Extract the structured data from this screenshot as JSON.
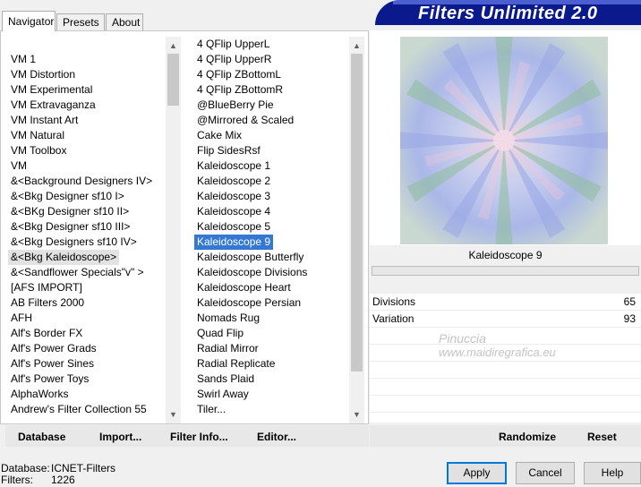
{
  "tabs": [
    "Navigator",
    "Presets",
    "About"
  ],
  "banner_title": "Filters Unlimited 2.0",
  "categories": [
    "VM 1",
    "VM Distortion",
    "VM Experimental",
    "VM Extravaganza",
    "VM Instant Art",
    "VM Natural",
    "VM Toolbox",
    "VM",
    "&<Background Designers IV>",
    "&<Bkg Designer sf10 I>",
    "&<BKg Designer sf10 II>",
    "&<Bkg Designer sf10 III>",
    "&<Bkg Designers sf10 IV>",
    "&<Bkg Kaleidoscope>",
    "&<Sandflower Specials\"v\" >",
    "[AFS IMPORT]",
    "AB Filters 2000",
    "AFH",
    "Alf's Border FX",
    "Alf's Power Grads",
    "Alf's Power Sines",
    "Alf's Power Toys",
    "AlphaWorks",
    "Andrew's Filter Collection 55"
  ],
  "categories_highlighted_index": 13,
  "filters": [
    "4 QFlip UpperL",
    "4 QFlip UpperR",
    "4 QFlip ZBottomL",
    "4 QFlip ZBottomR",
    "@BlueBerry Pie",
    "@Mirrored & Scaled",
    "Cake Mix",
    "Flip SidesRsf",
    "Kaleidoscope 1",
    "Kaleidoscope 2",
    "Kaleidoscope 3",
    "Kaleidoscope 4",
    "Kaleidoscope 5",
    "Kaleidoscope 9",
    "Kaleidoscope Butterfly",
    "Kaleidoscope Divisions",
    "Kaleidoscope Heart",
    "Kaleidoscope Persian",
    "Nomads Rug",
    "Quad Flip",
    "Radial Mirror",
    "Radial Replicate",
    "Sands Plaid",
    "Swirl Away",
    "Tiler..."
  ],
  "filters_selected_index": 13,
  "left_buttons": {
    "database": "Database",
    "import": "Import...",
    "filter_info": "Filter Info...",
    "editor": "Editor..."
  },
  "selected_filter_name": "Kaleidoscope 9",
  "params": [
    {
      "label": "Divisions",
      "value": "65"
    },
    {
      "label": "Variation",
      "value": "93"
    }
  ],
  "right_buttons": {
    "randomize": "Randomize",
    "reset": "Reset"
  },
  "watermark_lines": [
    "Pinuccia",
    "www.maidiregrafica.eu"
  ],
  "status": {
    "database_label": "Database:",
    "database_value": "ICNET-Filters",
    "filters_label": "Filters:",
    "filters_value": "1226"
  },
  "dialog_buttons": {
    "apply": "Apply",
    "cancel": "Cancel",
    "help": "Help"
  },
  "colors": {
    "banner": "#0a1a8c",
    "selection": "#3478d4",
    "default_button_border": "#0078d7"
  }
}
